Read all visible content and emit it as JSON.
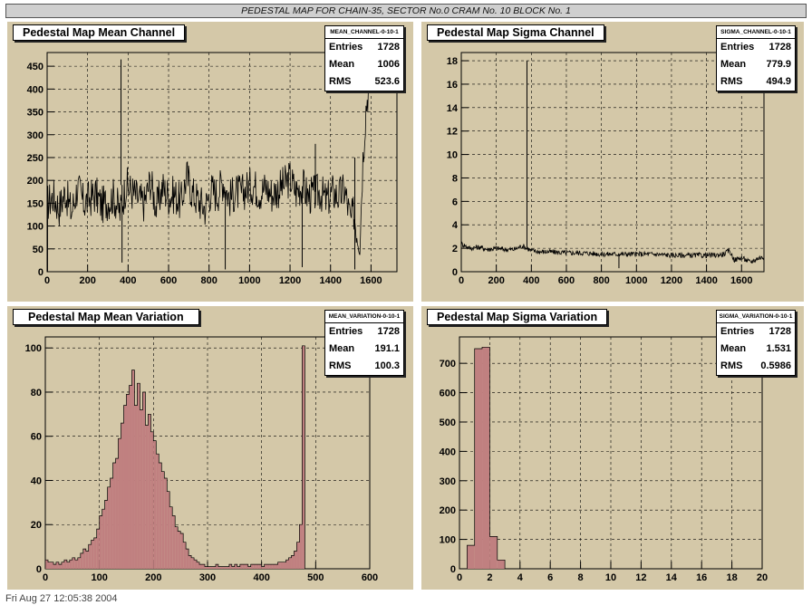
{
  "page_title": "PEDESTAL MAP FOR CHAIN-35, SECTOR No.0 CRAM No. 10 BLOCK No. 1",
  "footer_text": "Fri Aug 27 12:05:38 2004",
  "colors": {
    "pad": "#d4c8a8",
    "hist_fill": "#c08080",
    "line": "#000000"
  },
  "chart_data": [
    {
      "type": "line",
      "title": "Pedestal Map Mean Channel",
      "stats": {
        "name": "MEAN_CHANNEL-0-10-1",
        "rows": [
          [
            "Entries",
            "1728"
          ],
          [
            "Mean",
            "1006"
          ],
          [
            "RMS",
            "523.6"
          ]
        ]
      },
      "xlim": [
        0,
        1728
      ],
      "ylim": [
        0,
        480
      ],
      "xticks": [
        0,
        200,
        400,
        600,
        800,
        1000,
        1200,
        1400,
        1600
      ],
      "yticks": [
        0,
        50,
        100,
        150,
        200,
        250,
        300,
        350,
        400,
        450
      ],
      "x": [
        0,
        30,
        60,
        90,
        120,
        150,
        180,
        210,
        240,
        270,
        300,
        330,
        360,
        390,
        420,
        450,
        480,
        510,
        540,
        570,
        600,
        630,
        660,
        690,
        720,
        750,
        780,
        810,
        840,
        870,
        900,
        930,
        960,
        990,
        1020,
        1050,
        1080,
        1110,
        1140,
        1170,
        1200,
        1230,
        1260,
        1290,
        1320,
        1350,
        1380,
        1410,
        1440,
        1470,
        1500,
        1515,
        1530,
        1545,
        1560,
        1575,
        1590,
        1605,
        1620,
        1650,
        1680,
        1710
      ],
      "y": [
        150,
        165,
        140,
        175,
        130,
        185,
        150,
        160,
        170,
        145,
        155,
        165,
        130,
        190,
        175,
        160,
        150,
        200,
        140,
        185,
        165,
        170,
        150,
        210,
        170,
        155,
        140,
        180,
        170,
        200,
        160,
        175,
        170,
        185,
        190,
        175,
        185,
        170,
        180,
        190,
        205,
        175,
        190,
        165,
        170,
        175,
        155,
        175,
        165,
        180,
        110,
        130,
        90,
        70,
        250,
        360,
        410,
        480,
        480,
        480,
        480,
        480
      ],
      "spikes": [
        {
          "x": 2,
          "y": 0
        },
        {
          "x": 365,
          "y": 465
        },
        {
          "x": 370,
          "y": 20
        },
        {
          "x": 880,
          "y": 5
        },
        {
          "x": 1260,
          "y": 10
        },
        {
          "x": 1325,
          "y": 280
        },
        {
          "x": 1520,
          "y": 5
        }
      ]
    },
    {
      "type": "line",
      "title": "Pedestal Map Sigma Channel",
      "stats": {
        "name": "SIGMA_CHANNEL-0-10-1",
        "rows": [
          [
            "Entries",
            "1728"
          ],
          [
            "Mean",
            "779.9"
          ],
          [
            "RMS",
            "494.9"
          ]
        ]
      },
      "xlim": [
        0,
        1728
      ],
      "ylim": [
        0,
        18.7
      ],
      "xticks": [
        0,
        200,
        400,
        600,
        800,
        1000,
        1200,
        1400,
        1600
      ],
      "yticks": [
        0,
        2,
        4,
        6,
        8,
        10,
        12,
        14,
        16,
        18
      ],
      "x": [
        0,
        50,
        100,
        150,
        200,
        250,
        300,
        350,
        400,
        450,
        500,
        600,
        700,
        800,
        900,
        1000,
        1100,
        1200,
        1300,
        1400,
        1450,
        1500,
        1530,
        1560,
        1600,
        1650,
        1700,
        1728
      ],
      "y": [
        2.4,
        2.0,
        2.1,
        1.9,
        2.0,
        1.9,
        1.9,
        2.2,
        1.8,
        1.7,
        1.7,
        1.6,
        1.6,
        1.5,
        1.5,
        1.5,
        1.5,
        1.4,
        1.4,
        1.4,
        1.4,
        1.5,
        1.8,
        1.0,
        1.2,
        0.8,
        1.2,
        1.2
      ],
      "spikes": [
        {
          "x": 375,
          "y": 18.0
        },
        {
          "x": 900,
          "y": 0.3
        }
      ]
    },
    {
      "type": "bar",
      "title": "Pedestal Map Mean Variation",
      "stats": {
        "name": "MEAN_VARIATION-0-10-1",
        "rows": [
          [
            "Entries",
            "1728"
          ],
          [
            "Mean",
            "191.1"
          ],
          [
            "RMS",
            "100.3"
          ]
        ]
      },
      "xlim": [
        0,
        600
      ],
      "ylim": [
        0,
        105
      ],
      "xticks": [
        0,
        100,
        200,
        300,
        400,
        500,
        600
      ],
      "yticks": [
        0,
        20,
        40,
        60,
        80,
        100
      ],
      "bin_width": 5,
      "bin_start": 0,
      "values": [
        4,
        3,
        3,
        2,
        3,
        2,
        3,
        4,
        3,
        4,
        5,
        4,
        5,
        7,
        9,
        8,
        11,
        13,
        14,
        18,
        24,
        27,
        31,
        37,
        41,
        48,
        50,
        59,
        66,
        74,
        79,
        83,
        90,
        74,
        84,
        72,
        80,
        65,
        70,
        62,
        58,
        52,
        48,
        44,
        41,
        35,
        28,
        24,
        19,
        17,
        16,
        12,
        9,
        6,
        5,
        4,
        3,
        2,
        2,
        1,
        1,
        1,
        1,
        2,
        1,
        1,
        1,
        1,
        2,
        1,
        2,
        1,
        2,
        2,
        2,
        1,
        2,
        2,
        2,
        2,
        1,
        2,
        2,
        2,
        2,
        2,
        3,
        3,
        3,
        4,
        5,
        6,
        8,
        12,
        20,
        101,
        0,
        0,
        0,
        0,
        0,
        0,
        0,
        0,
        0,
        0,
        0,
        0,
        0,
        0,
        0,
        0,
        0,
        0,
        0,
        0,
        0,
        0,
        0,
        0
      ]
    },
    {
      "type": "bar",
      "title": "Pedestal Map Sigma Variation",
      "stats": {
        "name": "SIGMA_VARIATION-0-10-1",
        "rows": [
          [
            "Entries",
            "1728"
          ],
          [
            "Mean",
            "1.531"
          ],
          [
            "RMS",
            "0.5986"
          ]
        ]
      },
      "xlim": [
        0,
        20
      ],
      "ylim": [
        0,
        790
      ],
      "xticks": [
        0,
        2,
        4,
        6,
        8,
        10,
        12,
        14,
        16,
        18,
        20
      ],
      "yticks": [
        0,
        100,
        200,
        300,
        400,
        500,
        600,
        700
      ],
      "bin_width": 0.5,
      "bin_start": 0,
      "values": [
        0,
        80,
        750,
        755,
        110,
        30,
        0,
        0,
        0,
        0,
        0,
        0,
        0,
        0,
        0,
        0,
        0,
        0,
        0,
        0,
        0,
        0,
        0,
        0,
        0,
        0,
        0,
        0,
        0,
        0,
        0,
        0,
        0,
        0,
        0,
        0,
        0,
        0,
        0,
        0
      ]
    }
  ]
}
